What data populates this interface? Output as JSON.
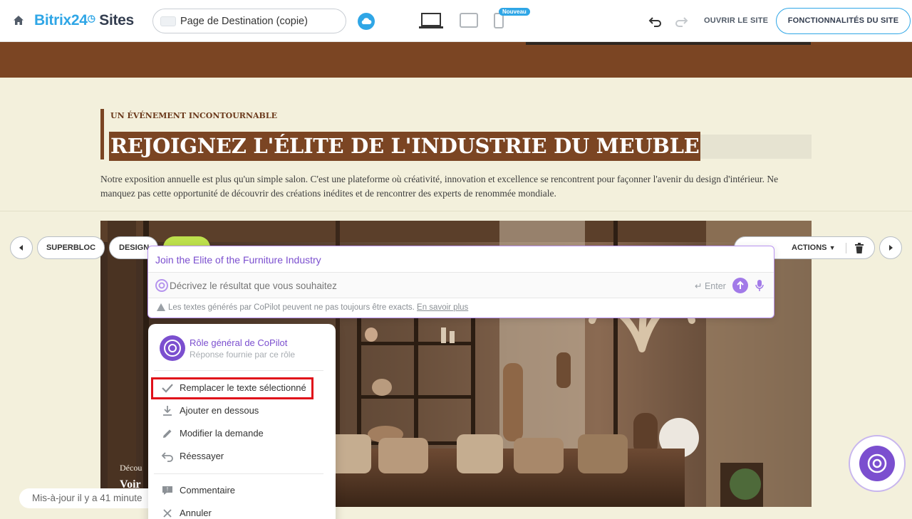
{
  "topbar": {
    "logo_part1": "Bitrix24",
    "logo_part2": "Sites",
    "page_name": "Page de Destination (copie)",
    "new_badge": "Nouveau",
    "open_site": "OUVRIR LE SITE",
    "site_features": "FONCTIONNALITÉS DU SITE"
  },
  "page": {
    "eyebrow": "UN ÉVÉNEMENT INCONTOURNABLE",
    "headline": "REJOIGNEZ L'ÉLITE DE L'INDUSTRIE DU MEUBLE",
    "paragraph": "Notre exposition annuelle est plus qu'un simple salon. C'est une plateforme où créativité, innovation et excellence se rencontrent pour façonner l'avenir du design d'intérieur. Ne manquez pas cette opportunité de découvrir des créations inédites et de rencontrer des experts de renommée mondiale.",
    "photo_text1": "Décou",
    "photo_text2": "Voir"
  },
  "block_controls": {
    "superbloc": "SUPERBLOC",
    "design": "DESIGN",
    "actions": "ACTIONS"
  },
  "copilot": {
    "title": "Join the Elite of the Furniture Industry",
    "placeholder": "Décrivez le résultat que vous souhaitez",
    "enter_hint": "Enter",
    "disclaimer": "Les textes générés par CoPilot peuvent ne pas toujours être exacts.",
    "learn_more": "En savoir plus"
  },
  "menu": {
    "role_title": "Rôle général de CoPilot",
    "role_subtitle": "Réponse fournie par ce rôle",
    "items": [
      {
        "label": "Remplacer le texte sélectionné",
        "icon": "check-icon"
      },
      {
        "label": "Ajouter en dessous",
        "icon": "download-icon"
      },
      {
        "label": "Modifier la demande",
        "icon": "pencil-icon"
      },
      {
        "label": "Réessayer",
        "icon": "retry-icon"
      },
      {
        "label": "Commentaire",
        "icon": "comment-icon"
      },
      {
        "label": "Annuler",
        "icon": "close-icon"
      }
    ]
  },
  "status": {
    "updated": "Mis-à-jour il y a 41 minute"
  },
  "colors": {
    "accent_blue": "#2fa6e6",
    "brown": "#7b4523",
    "copilot_purple": "#7b4fcf",
    "highlight_red": "#e0101a"
  }
}
